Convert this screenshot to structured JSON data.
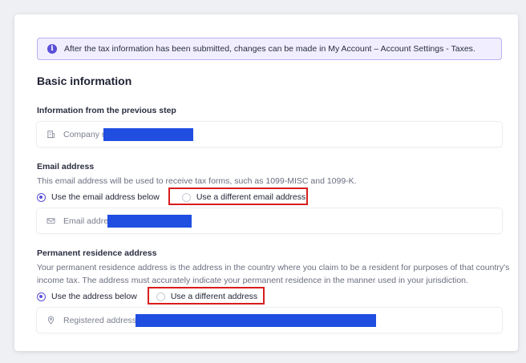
{
  "notice": {
    "text": "After the tax information has been submitted, changes can be made in My Account – Account Settings - Taxes."
  },
  "section": {
    "title": "Basic information"
  },
  "previous_step": {
    "label": "Information from the previous step",
    "company_placeholder": "Company n"
  },
  "email": {
    "label": "Email address",
    "description": "This email address will be used to receive tax forms, such as 1099-MISC and 1099-K.",
    "option_below": "Use the email address below",
    "option_different": "Use a different email address",
    "field_placeholder": "Email addres"
  },
  "residence": {
    "label": "Permanent residence address",
    "description_line1": "Your permanent residence address is the address in the country where you claim to be a resident for purposes of that country's",
    "description_line2": "income tax. The address must accurately indicate your permanent residence in the manner used in your jurisdiction.",
    "option_below": "Use the address below",
    "option_different": "Use a different address",
    "field_placeholder": "Registered address"
  },
  "colors": {
    "accent": "#5a4fd8",
    "highlight": "#d81d1d",
    "redaction": "#1f4ee0"
  }
}
